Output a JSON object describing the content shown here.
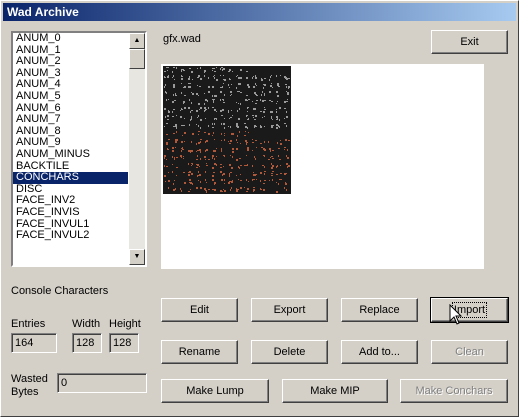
{
  "window": {
    "title": "Wad Archive"
  },
  "lumps": {
    "items": [
      "ANUM_0",
      "ANUM_1",
      "ANUM_2",
      "ANUM_3",
      "ANUM_4",
      "ANUM_5",
      "ANUM_6",
      "ANUM_7",
      "ANUM_8",
      "ANUM_9",
      "ANUM_MINUS",
      "BACKTILE",
      "CONCHARS",
      "DISC",
      "FACE_INV2",
      "FACE_INVIS",
      "FACE_INVUL1",
      "FACE_INVUL2"
    ],
    "selected_index": 12
  },
  "wad_file": "gfx.wad",
  "description": "Console Characters",
  "entries": {
    "label": "Entries",
    "value": "164"
  },
  "width": {
    "label": "Width",
    "value": "128"
  },
  "height": {
    "label": "Height",
    "value": "128"
  },
  "wasted": {
    "label_line1": "Wasted",
    "label_line2": "Bytes",
    "value": "0"
  },
  "buttons": {
    "exit": "Exit",
    "edit": "Edit",
    "export": "Export",
    "replace": "Replace",
    "import": "Import",
    "rename": "Rename",
    "delete": "Delete",
    "add_to": "Add to...",
    "clean": "Clean",
    "make_lump": "Make Lump",
    "make_mip": "Make MIP",
    "make_conchars": "Make Conchars"
  },
  "icons": {
    "scroll_up": "arrow-up-icon",
    "scroll_down": "arrow-down-icon",
    "cursor": "mouse-pointer-icon"
  },
  "colors": {
    "title_start": "#0a246a",
    "title_end": "#a6caf0",
    "selection": "#0a246a",
    "face": "#d4d0c8",
    "charsheet_bg": "#1a1a1a",
    "char_upper": "#9a9a9a",
    "char_lower": "#b0583a"
  }
}
